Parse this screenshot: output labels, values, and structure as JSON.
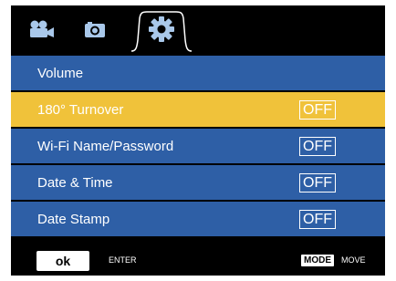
{
  "tabs": [
    {
      "icon": "video-camera-icon",
      "selected": false
    },
    {
      "icon": "photo-camera-icon",
      "selected": false
    },
    {
      "icon": "gear-icon",
      "selected": true
    }
  ],
  "menu": {
    "items": [
      {
        "label": "Volume",
        "value": ""
      },
      {
        "label": "180° Turnover",
        "value": "OFF",
        "highlighted": true
      },
      {
        "label": "Wi-Fi Name/Password",
        "value": "OFF"
      },
      {
        "label": "Date & Time",
        "value": "OFF"
      },
      {
        "label": "Date Stamp",
        "value": "OFF"
      }
    ]
  },
  "footer": {
    "ok_label": "ok",
    "enter_label": "ENTER",
    "mode_label": "MODE",
    "move_label": "MOVE"
  },
  "colors": {
    "row_background": "#2e5fa6",
    "highlight": "#f0c23a",
    "screen_background": "#000000",
    "icon_color": "#a9c8ea"
  }
}
